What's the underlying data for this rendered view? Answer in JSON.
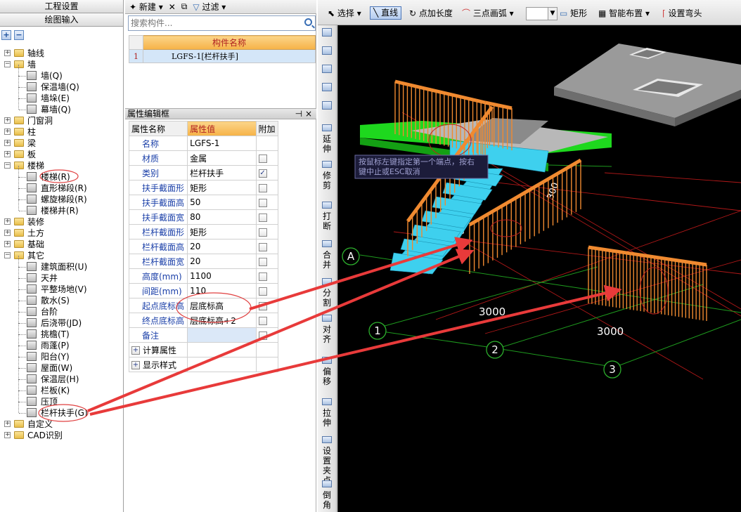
{
  "nav": {
    "tab1": "工程设置",
    "tab2": "绘图输入",
    "tools": [
      "+",
      "−"
    ],
    "tree": [
      {
        "label": "轴线",
        "level": 0,
        "expanded": false,
        "icon": "folder-icon"
      },
      {
        "label": "墙",
        "level": 0,
        "expanded": true,
        "icon": "folder-icon"
      },
      {
        "label": "墙(Q)",
        "level": 1,
        "icon": "wall-icon"
      },
      {
        "label": "保温墙(Q)",
        "level": 1,
        "icon": "insulation-wall-icon"
      },
      {
        "label": "墙垛(E)",
        "level": 1,
        "icon": "wall-pier-icon"
      },
      {
        "label": "幕墙(Q)",
        "level": 1,
        "icon": "curtain-wall-icon"
      },
      {
        "label": "门窗洞",
        "level": 0,
        "expanded": false,
        "icon": "folder-icon"
      },
      {
        "label": "柱",
        "level": 0,
        "expanded": false,
        "icon": "folder-icon"
      },
      {
        "label": "梁",
        "level": 0,
        "expanded": false,
        "icon": "folder-icon"
      },
      {
        "label": "板",
        "level": 0,
        "expanded": false,
        "icon": "folder-icon"
      },
      {
        "label": "楼梯",
        "level": 0,
        "expanded": true,
        "icon": "folder-icon"
      },
      {
        "label": "楼梯(R)",
        "level": 1,
        "icon": "stair-icon"
      },
      {
        "label": "直形梯段(R)",
        "level": 1,
        "icon": "straight-flight-icon"
      },
      {
        "label": "螺旋梯段(R)",
        "level": 1,
        "icon": "spiral-flight-icon"
      },
      {
        "label": "楼梯井(R)",
        "level": 1,
        "icon": "stairwell-icon"
      },
      {
        "label": "装修",
        "level": 0,
        "expanded": false,
        "icon": "folder-icon"
      },
      {
        "label": "土方",
        "level": 0,
        "expanded": false,
        "icon": "folder-icon"
      },
      {
        "label": "基础",
        "level": 0,
        "expanded": false,
        "icon": "folder-icon"
      },
      {
        "label": "其它",
        "level": 0,
        "expanded": true,
        "icon": "folder-icon"
      },
      {
        "label": "建筑面积(U)",
        "level": 1,
        "icon": "building-area-icon"
      },
      {
        "label": "天井",
        "level": 1,
        "icon": "courtyard-icon"
      },
      {
        "label": "平整场地(V)",
        "level": 1,
        "icon": "site-leveling-icon"
      },
      {
        "label": "散水(S)",
        "level": 1,
        "icon": "apron-icon"
      },
      {
        "label": "台阶",
        "level": 1,
        "icon": "steps-icon"
      },
      {
        "label": "后浇带(JD)",
        "level": 1,
        "icon": "post-cast-strip-icon"
      },
      {
        "label": "挑檐(T)",
        "level": 1,
        "icon": "eave-icon"
      },
      {
        "label": "雨蓬(P)",
        "level": 1,
        "icon": "canopy-icon"
      },
      {
        "label": "阳台(Y)",
        "level": 1,
        "icon": "balcony-icon"
      },
      {
        "label": "屋面(W)",
        "level": 1,
        "icon": "roof-icon"
      },
      {
        "label": "保温层(H)",
        "level": 1,
        "icon": "insulation-layer-icon"
      },
      {
        "label": "栏板(K)",
        "level": 1,
        "icon": "parapet-icon"
      },
      {
        "label": "压顶",
        "level": 1,
        "icon": "coping-icon"
      },
      {
        "label": "栏杆扶手(G)",
        "level": 1,
        "icon": "railing-icon"
      },
      {
        "label": "自定义",
        "level": 0,
        "expanded": false,
        "icon": "folder-icon"
      },
      {
        "label": "CAD识别",
        "level": 0,
        "expanded": false,
        "icon": "folder-icon"
      }
    ]
  },
  "toolbar1": {
    "new_label": "新建",
    "filter_label": "过滤"
  },
  "search": {
    "placeholder": "搜索构件..."
  },
  "components": {
    "header": "构件名称",
    "rows": [
      {
        "index": "1",
        "name": "LGFS-1[栏杆扶手]"
      }
    ]
  },
  "props": {
    "title": "属性编辑框",
    "pin": "⊣ ×",
    "headers": [
      "属性名称",
      "属性值",
      "附加"
    ],
    "rows": [
      {
        "name": "名称",
        "value": "LGFS-1",
        "check": null
      },
      {
        "name": "材质",
        "value": "金属",
        "check": false
      },
      {
        "name": "类别",
        "value": "栏杆扶手",
        "check": true
      },
      {
        "name": "扶手截面形",
        "value": "矩形",
        "check": false
      },
      {
        "name": "扶手截面高",
        "value": "50",
        "check": false
      },
      {
        "name": "扶手截面宽",
        "value": "80",
        "check": false
      },
      {
        "name": "栏杆截面形",
        "value": "矩形",
        "check": false
      },
      {
        "name": "栏杆截面高",
        "value": "20",
        "check": false
      },
      {
        "name": "栏杆截面宽",
        "value": "20",
        "check": false
      },
      {
        "name": "高度(mm)",
        "value": "1100",
        "check": false
      },
      {
        "name": "间距(mm)",
        "value": "110",
        "check": false
      },
      {
        "name": "起点底标高",
        "value": "层底标高",
        "check": false
      },
      {
        "name": "终点底标高",
        "value": "层底标高+2",
        "check": false
      },
      {
        "name": "备注",
        "value": "",
        "check": false
      },
      {
        "name": "计算属性",
        "value": "",
        "check": null,
        "group": true
      },
      {
        "name": "显示样式",
        "value": "",
        "check": null,
        "group": true
      }
    ]
  },
  "vstrip": [
    "延伸",
    "修剪",
    "打断",
    "合并",
    "分割",
    "对齐",
    "偏移",
    "拉伸",
    "设置夹点",
    "倒角"
  ],
  "rtoolbar": {
    "select": "选择",
    "line": "直线",
    "point_len": "点加长度",
    "arc3": "三点画弧",
    "rect": "矩形",
    "smart": "智能布置",
    "bend": "设置弯头"
  },
  "viewport": {
    "tooltip": "按鼠标左键指定第一个端点，按右键中止或ESC取消",
    "axis_a": "A",
    "axis_1": "1",
    "axis_2": "2",
    "axis_3": "3",
    "dim1": "3000",
    "dim2": "3000",
    "dim3": "300",
    "dim4": "00",
    "colors": {
      "stair": "#3fd6f0",
      "landing": "#22e022",
      "railing": "#f08a30",
      "grid": "#c02020",
      "axis": "#20a020",
      "arrow": "#e83a3a"
    }
  }
}
